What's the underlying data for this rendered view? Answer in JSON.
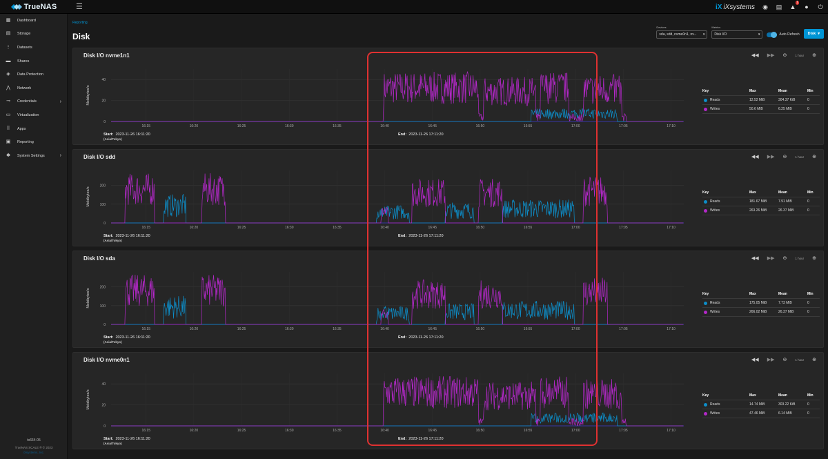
{
  "app": {
    "brand": "TrueNAS",
    "edition": "SCALE",
    "vendor": "iXsystems",
    "notification_count": "1"
  },
  "sidebar": {
    "items": [
      {
        "label": "Dashboard",
        "icon": "dashboard-icon",
        "glyph": "▦",
        "has_children": false
      },
      {
        "label": "Storage",
        "icon": "storage-icon",
        "glyph": "▤",
        "has_children": false
      },
      {
        "label": "Datasets",
        "icon": "datasets-icon",
        "glyph": "⋮",
        "has_children": false
      },
      {
        "label": "Shares",
        "icon": "folder-icon",
        "glyph": "▬",
        "has_children": false
      },
      {
        "label": "Data Protection",
        "icon": "shield-icon",
        "glyph": "◈",
        "has_children": false
      },
      {
        "label": "Network",
        "icon": "network-icon",
        "glyph": "⋀",
        "has_children": false
      },
      {
        "label": "Credentials",
        "icon": "key-icon",
        "glyph": "⊸",
        "has_children": true
      },
      {
        "label": "Virtualization",
        "icon": "monitor-icon",
        "glyph": "▭",
        "has_children": false
      },
      {
        "label": "Apps",
        "icon": "apps-icon",
        "glyph": "⠿",
        "has_children": false
      },
      {
        "label": "Reporting",
        "icon": "reporting-icon",
        "glyph": "▣",
        "has_children": false
      },
      {
        "label": "System Settings",
        "icon": "gear-icon",
        "glyph": "✱",
        "has_children": true
      }
    ],
    "hostname": "tx664-05",
    "version": "TrueNAS SCALE ® © 2023",
    "copyright": "iXsystems, Inc."
  },
  "header": {
    "breadcrumb": "Reporting",
    "title": "Disk",
    "devices_label": "Devices",
    "devices_value": "sda, sdd, nvme0n1, nv...",
    "metrics_label": "Metrics",
    "metrics_value": "Disk I/O",
    "auto_refresh_label": "Auto Refresh",
    "auto_refresh_on": true,
    "disk_button": "Disk"
  },
  "time_axis_ticks": [
    "16:15",
    "16:20",
    "16:25",
    "16:30",
    "16:35",
    "16:40",
    "16:45",
    "16:50",
    "16:55",
    "17:00",
    "17:05",
    "17:10"
  ],
  "colors": {
    "reads": "#0d8ec9",
    "writes": "#b428c9"
  },
  "common": {
    "ylabel": "Mebibytes/s",
    "start_label": "Start:",
    "start_value": "2023-11-26 16:11:20",
    "end_label": "End:",
    "end_value": "2023-11-26 17:11:20",
    "timezone": "(Asia/Tokyo)",
    "range": "1 hour",
    "legend_headers": [
      "Key",
      "Max",
      "Mean",
      "Min"
    ]
  },
  "charts": [
    {
      "title": "Disk I/O nvme1n1",
      "yticks": [
        "0",
        "20",
        "40"
      ],
      "ymax": 50,
      "legend": [
        {
          "name": "Reads",
          "max": "12.52 MiB",
          "mean": "304.37 KiB",
          "min": "0"
        },
        {
          "name": "Writes",
          "max": "50.6 MiB",
          "mean": "6.25 MiB",
          "min": "0"
        }
      ]
    },
    {
      "title": "Disk I/O sdd",
      "yticks": [
        "0",
        "100",
        "200"
      ],
      "ymax": 280,
      "legend": [
        {
          "name": "Reads",
          "max": "181.67 MiB",
          "mean": "7.91 MiB",
          "min": "0"
        },
        {
          "name": "Writes",
          "max": "263.26 MiB",
          "mean": "26.37 MiB",
          "min": "0"
        }
      ]
    },
    {
      "title": "Disk I/O sda",
      "yticks": [
        "0",
        "100",
        "200"
      ],
      "ymax": 280,
      "legend": [
        {
          "name": "Reads",
          "max": "175.05 MiB",
          "mean": "7.73 MiB",
          "min": "0"
        },
        {
          "name": "Writes",
          "max": "266.02 MiB",
          "mean": "26.37 MiB",
          "min": "0"
        }
      ]
    },
    {
      "title": "Disk I/O nvme0n1",
      "yticks": [
        "0",
        "20",
        "40"
      ],
      "ymax": 50,
      "legend": [
        {
          "name": "Reads",
          "max": "14.74 MiB",
          "mean": "303.22 KiB",
          "min": "0"
        },
        {
          "name": "Writes",
          "max": "47.46 MiB",
          "mean": "6.14 MiB",
          "min": "0"
        }
      ]
    }
  ]
}
